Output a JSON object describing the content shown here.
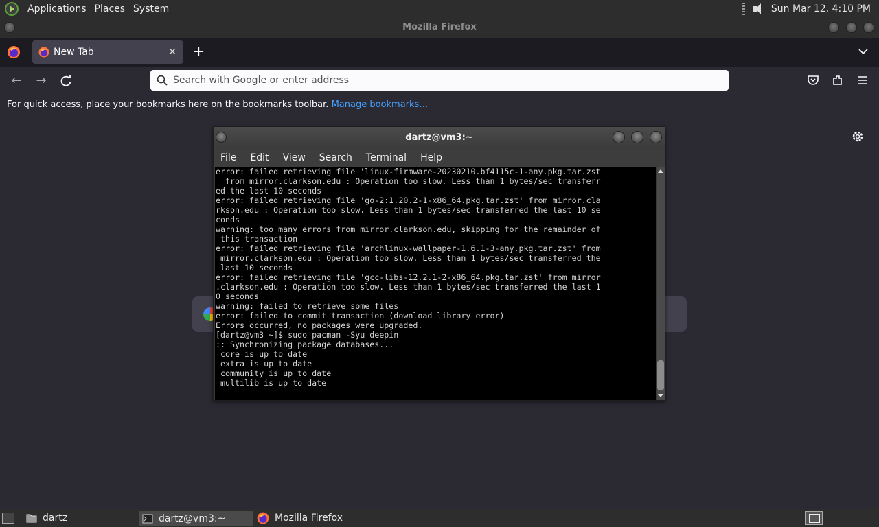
{
  "top_panel": {
    "menus": [
      "Applications",
      "Places",
      "System"
    ],
    "clock": "Sun Mar 12,  4:10 PM"
  },
  "firefox": {
    "window_title": "Mozilla Firefox",
    "tab_label": "New Tab",
    "new_tab_symbol": "+",
    "url_placeholder": "Search with Google or enter address",
    "bookmarks_text": "For quick access, place your bookmarks here on the bookmarks toolbar.",
    "manage_bookmarks": "Manage bookmarks…"
  },
  "terminal": {
    "title": "dartz@vm3:~",
    "menu": [
      "File",
      "Edit",
      "View",
      "Search",
      "Terminal",
      "Help"
    ],
    "output": "error: failed retrieving file 'linux-firmware-20230210.bf4115c-1-any.pkg.tar.zst\n' from mirror.clarkson.edu : Operation too slow. Less than 1 bytes/sec transferr\ned the last 10 seconds\nerror: failed retrieving file 'go-2:1.20.2-1-x86_64.pkg.tar.zst' from mirror.cla\nrkson.edu : Operation too slow. Less than 1 bytes/sec transferred the last 10 se\nconds\nwarning: too many errors from mirror.clarkson.edu, skipping for the remainder of\n this transaction\nerror: failed retrieving file 'archlinux-wallpaper-1.6.1-3-any.pkg.tar.zst' from\n mirror.clarkson.edu : Operation too slow. Less than 1 bytes/sec transferred the\n last 10 seconds\nerror: failed retrieving file 'gcc-libs-12.2.1-2-x86_64.pkg.tar.zst' from mirror\n.clarkson.edu : Operation too slow. Less than 1 bytes/sec transferred the last 1\n0 seconds\nwarning: failed to retrieve some files\nerror: failed to commit transaction (download library error)\nErrors occurred, no packages were upgraded.\n[dartz@vm3 ~]$ sudo pacman -Syu deepin\n:: Synchronizing package databases...\n core is up to date\n extra is up to date\n community is up to date\n multilib is up to date"
  },
  "taskbar": {
    "items": [
      "dartz",
      "dartz@vm3:~",
      "Mozilla Firefox"
    ]
  },
  "icons": {
    "os_logo": "mate-logo-icon",
    "volume": "speaker-icon",
    "firefox": "firefox-icon",
    "folder": "folder-icon",
    "terminal": "terminal-icon",
    "settings": "gear-icon"
  }
}
